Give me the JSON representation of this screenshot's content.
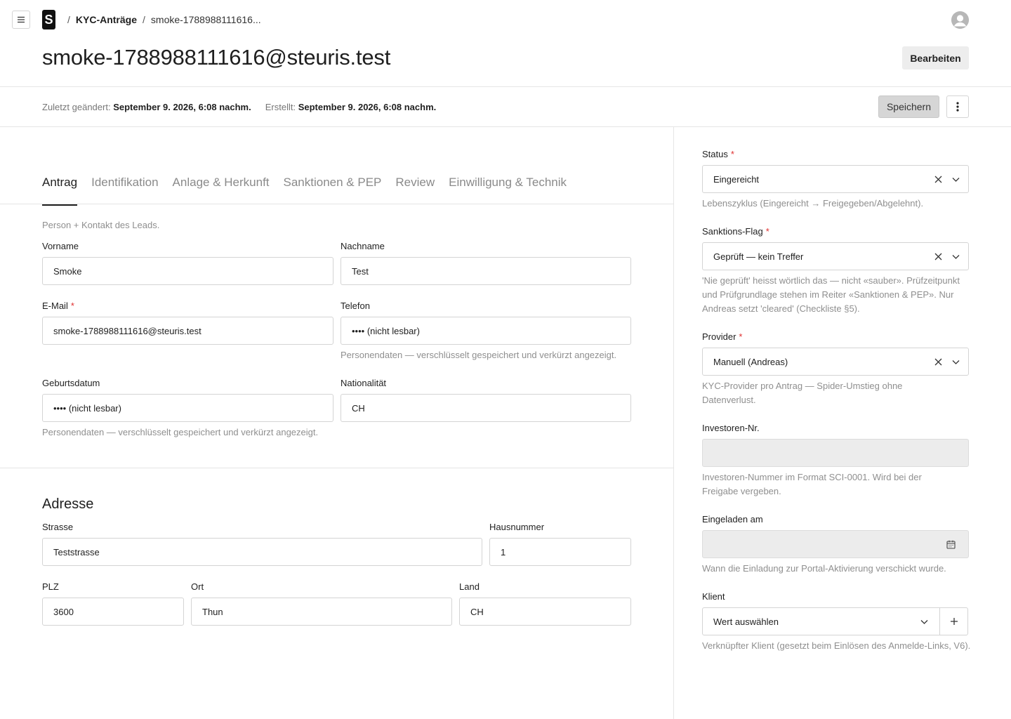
{
  "breadcrumb": {
    "logo": "S",
    "section": "KYC-Anträge",
    "current": "smoke-1788988111616..."
  },
  "header": {
    "title": "smoke-1788988111616@steuris.test",
    "edit_label": "Bearbeiten"
  },
  "meta": {
    "changed_label": "Zuletzt geändert:",
    "changed_value": "September 9. 2026, 6:08 nachm.",
    "created_label": "Erstellt:",
    "created_value": "September 9. 2026, 6:08 nachm.",
    "save_label": "Speichern"
  },
  "tabs": [
    "Antrag",
    "Identifikation",
    "Anlage & Herkunft",
    "Sanktionen & PEP",
    "Review",
    "Einwilligung & Technik"
  ],
  "person": {
    "description": "Person + Kontakt des Leads.",
    "firstname_label": "Vorname",
    "firstname_value": "Smoke",
    "lastname_label": "Nachname",
    "lastname_value": "Test",
    "email_label": "E-Mail",
    "email_value": "smoke-1788988111616@steuris.test",
    "phone_label": "Telefon",
    "phone_value": "•••• (nicht lesbar)",
    "phone_hint": "Personendaten — verschlüsselt gespeichert und verkürzt angezeigt.",
    "birthdate_label": "Geburtsdatum",
    "birthdate_value": "•••• (nicht lesbar)",
    "birthdate_hint": "Personendaten — verschlüsselt gespeichert und verkürzt angezeigt.",
    "nationality_label": "Nationalität",
    "nationality_value": "CH"
  },
  "address": {
    "title": "Adresse",
    "street_label": "Strasse",
    "street_value": "Teststrasse",
    "number_label": "Hausnummer",
    "number_value": "1",
    "zip_label": "PLZ",
    "zip_value": "3600",
    "city_label": "Ort",
    "city_value": "Thun",
    "country_label": "Land",
    "country_value": "CH"
  },
  "sidebar": {
    "status_label": "Status",
    "status_value": "Eingereicht",
    "status_hint": "Lebenszyklus (Eingereicht → Freigegeben/Abgelehnt).",
    "sanction_label": "Sanktions-Flag",
    "sanction_value": "Geprüft — kein Treffer",
    "sanction_hint": "'Nie geprüft' heisst wörtlich das — nicht «sauber». Prüfzeitpunkt und Prüfgrundlage stehen im Reiter «Sanktionen & PEP». Nur Andreas setzt 'cleared' (Checkliste §5).",
    "provider_label": "Provider",
    "provider_value": "Manuell (Andreas)",
    "provider_hint": "KYC-Provider pro Antrag — Spider-Umstieg ohne Datenverlust.",
    "investor_label": "Investoren-Nr.",
    "investor_hint": "Investoren-Nummer im Format SCI-0001. Wird bei der Freigabe vergeben.",
    "invited_label": "Eingeladen am",
    "invited_hint": "Wann die Einladung zur Portal-Aktivierung verschickt wurde.",
    "client_label": "Klient",
    "client_value": "Wert auswählen",
    "client_hint": "Verknüpfter Klient (gesetzt beim Einlösen des Anmelde-Links, V6)."
  },
  "icons": {
    "menu": "hamburger-icon",
    "avatar": "user-avatar-icon",
    "more": "vertical-dots-icon",
    "clear": "x-icon",
    "dropdown": "chevron-down-icon",
    "calendar": "calendar-icon",
    "add": "plus-icon"
  }
}
